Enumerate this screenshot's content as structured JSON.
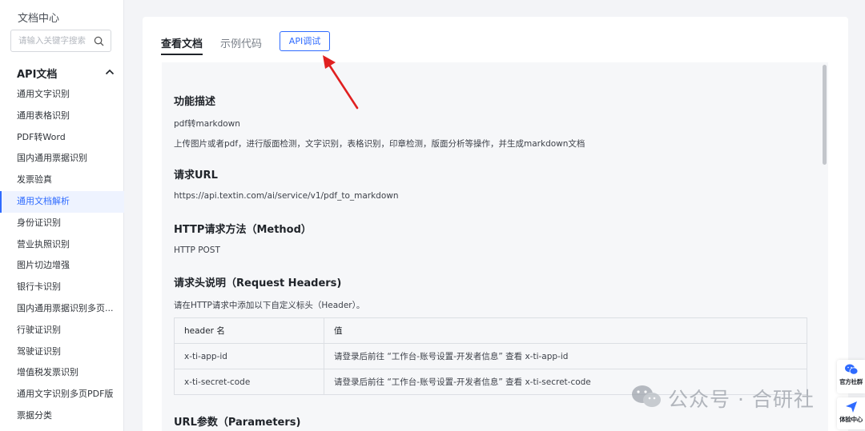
{
  "sidebar": {
    "title": "文档中心",
    "search_placeholder": "请输入关键字搜索",
    "section_label": "API文档",
    "items": [
      {
        "label": "通用文字识别"
      },
      {
        "label": "通用表格识别"
      },
      {
        "label": "PDF转Word"
      },
      {
        "label": "国内通用票据识别"
      },
      {
        "label": "发票验真"
      },
      {
        "label": "通用文档解析",
        "active": true
      },
      {
        "label": "身份证识别"
      },
      {
        "label": "营业执照识别"
      },
      {
        "label": "图片切边增强"
      },
      {
        "label": "银行卡识别"
      },
      {
        "label": "国内通用票据识别多页..."
      },
      {
        "label": "行驶证识别"
      },
      {
        "label": "驾驶证识别"
      },
      {
        "label": "增值税发票识别"
      },
      {
        "label": "通用文字识别多页PDF版"
      },
      {
        "label": "票据分类"
      }
    ]
  },
  "tabs": {
    "view_doc": "查看文档",
    "example_code": "示例代码",
    "api_debug": "API调试"
  },
  "doc": {
    "feature_title": "功能描述",
    "feature_name": "pdf转markdown",
    "feature_desc": "上传图片或者pdf，进行版面检测，文字识别，表格识别，印章检测，版面分析等操作，并生成markdown文档",
    "url_title": "请求URL",
    "url": "https://api.textin.com/ai/service/v1/pdf_to_markdown",
    "method_title": "HTTP请求方法（Method）",
    "method": "HTTP POST",
    "headers_title": "请求头说明（Request Headers)",
    "headers_desc": "请在HTTP请求中添加以下自定义标头（Header）。",
    "headers_table": {
      "columns": [
        "header 名",
        "值"
      ],
      "rows": [
        [
          "x-ti-app-id",
          "请登录后前往 “工作台-账号设置-开发者信息” 查看 x-ti-app-id"
        ],
        [
          "x-ti-secret-code",
          "请登录后前往 “工作台-账号设置-开发者信息” 查看 x-ti-secret-code"
        ]
      ]
    },
    "params_title": "URL参数（Parameters)"
  },
  "floats": {
    "community": "官方社群",
    "experience": "体验中心"
  },
  "watermark": "公众号 · 合研社",
  "colors": {
    "accent": "#2f6bff",
    "arrow": "#e02020"
  }
}
